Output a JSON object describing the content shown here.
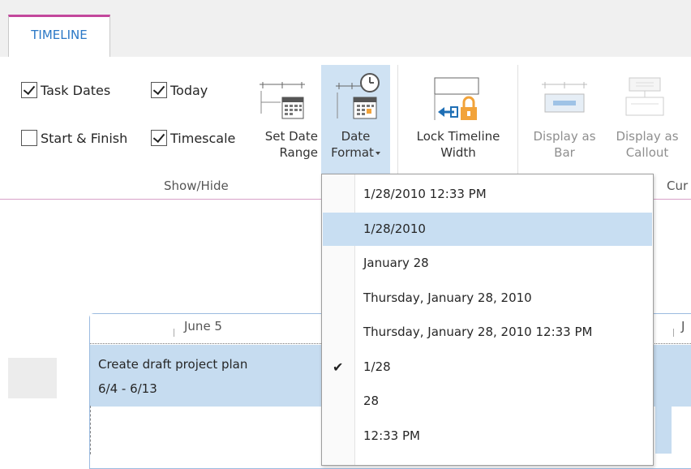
{
  "ribbon": {
    "tab_label": "TIMELINE",
    "show_hide": {
      "task_dates": "Task Dates",
      "today": "Today",
      "start_finish": "Start & Finish",
      "timescale": "Timescale",
      "task_dates_checked": true,
      "today_checked": true,
      "start_finish_checked": false,
      "timescale_checked": true,
      "group_label": "Show/Hide"
    },
    "buttons": {
      "set_date_range_1": "Set Date",
      "set_date_range_2": "Range",
      "date_format_1": "Date",
      "date_format_2": "Format",
      "lock_timeline_1": "Lock Timeline",
      "lock_timeline_2": "Width",
      "display_bar_1": "Display as",
      "display_bar_2": "Bar",
      "display_callout_1": "Display as",
      "display_callout_2": "Callout"
    },
    "current_group_label": "Cur"
  },
  "date_format_menu": {
    "items": [
      {
        "label": "1/28/2010 12:33 PM"
      },
      {
        "label": "1/28/2010"
      },
      {
        "label": "January 28"
      },
      {
        "label": "Thursday, January 28, 2010"
      },
      {
        "label": "Thursday, January 28, 2010 12:33 PM"
      },
      {
        "label": "1/28"
      },
      {
        "label": "28"
      },
      {
        "label": "12:33 PM"
      }
    ],
    "highlighted": "1/28/2010",
    "checked": "1/28",
    "check_glyph": "✔"
  },
  "timeline": {
    "scale_left": "June 5",
    "scale_right": "J",
    "task": {
      "name": "Create draft project plan",
      "dates": "6/4 - 6/13"
    }
  },
  "colors": {
    "tab_accent": "#c3479c",
    "highlight": "#c8def2",
    "task_bar": "#c6dcf0",
    "button_active": "#cfe2f3"
  }
}
